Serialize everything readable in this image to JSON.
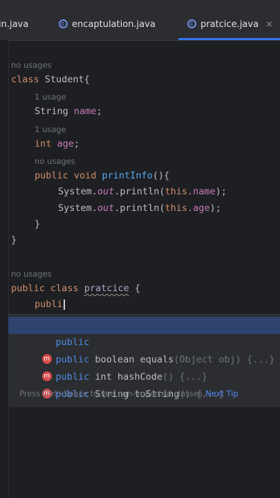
{
  "tabs": [
    {
      "label": "in.java"
    },
    {
      "label": "encaptulation.java"
    },
    {
      "label": "pratcice.java",
      "close": "×"
    }
  ],
  "code": {
    "hint_no_usages_1": "no usages",
    "class_kw": "class",
    "class_name": "Student{",
    "hint_1_usage_a": "1 usage",
    "type_string": "String",
    "field_name": "name",
    "semicolon": ";",
    "hint_1_usage_b": "1 usage",
    "type_int": "int",
    "field_age": "age",
    "hint_no_usages_2": "no usages",
    "method_mod": "public void",
    "method_name": "printInfo",
    "method_tail": "(){",
    "sys": "System.",
    "out": "out",
    "println": ".println(",
    "this_kw": "this",
    "dot_name": ".name",
    "dot_age": ".age",
    "close_call": ");",
    "brace_close": "}",
    "hint_no_usages_3": "no usages",
    "public_class_kw": "public class",
    "pratcice_name": "pratcice",
    "open_brace": "{",
    "typed": "publi"
  },
  "completion": {
    "items": [
      {
        "kw": "public",
        "rest": "",
        "dim": ""
      },
      {
        "kw": "public",
        "rest": " boolean equals",
        "dim": "(Object obj) {...}"
      },
      {
        "kw": "public",
        "rest": " int hashCode",
        "dim": "() {...}"
      },
      {
        "kw": "public",
        "rest": " String toString",
        "dim": "() {...}"
      }
    ],
    "method_icon": "m",
    "footer": "Press Ctrl+Space to see non-imported classes",
    "next_tip": "Next Tip"
  },
  "colors": {
    "background": "#1e1f22",
    "keyword": "#cf8e6d",
    "field": "#c77dbb",
    "function": "#56a8f5",
    "selection": "#2e436e",
    "accent": "#3574f0"
  }
}
